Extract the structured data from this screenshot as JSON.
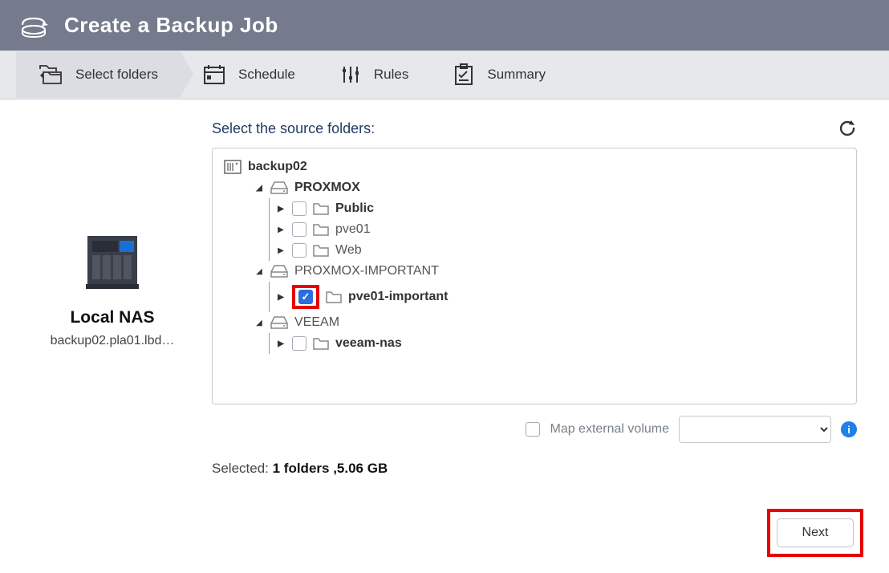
{
  "header": {
    "title": "Create a Backup Job"
  },
  "steps": {
    "select_folders": "Select folders",
    "schedule": "Schedule",
    "rules": "Rules",
    "summary": "Summary"
  },
  "left": {
    "nas_title": "Local NAS",
    "hostname": "backup02.pla01.lbd…"
  },
  "main": {
    "section_title": "Select the source folders:",
    "tree": {
      "root": {
        "label": "backup02"
      },
      "drives": [
        {
          "label": "PROXMOX",
          "expanded": true,
          "folders": [
            {
              "label": "Public",
              "checked": false
            },
            {
              "label": "pve01",
              "checked": false
            },
            {
              "label": "Web",
              "checked": false
            }
          ]
        },
        {
          "label": "PROXMOX-IMPORTANT",
          "expanded": true,
          "folders": [
            {
              "label": "pve01-important",
              "checked": true,
              "highlighted": true
            }
          ]
        },
        {
          "label": "VEEAM",
          "expanded": true,
          "folders": [
            {
              "label": "veeam-nas",
              "checked": false
            }
          ]
        }
      ]
    },
    "map_volume_label": "Map external volume",
    "selected_prefix": "Selected: ",
    "selected_value": "1 folders ,5.06 GB"
  },
  "footer": {
    "next": "Next"
  }
}
